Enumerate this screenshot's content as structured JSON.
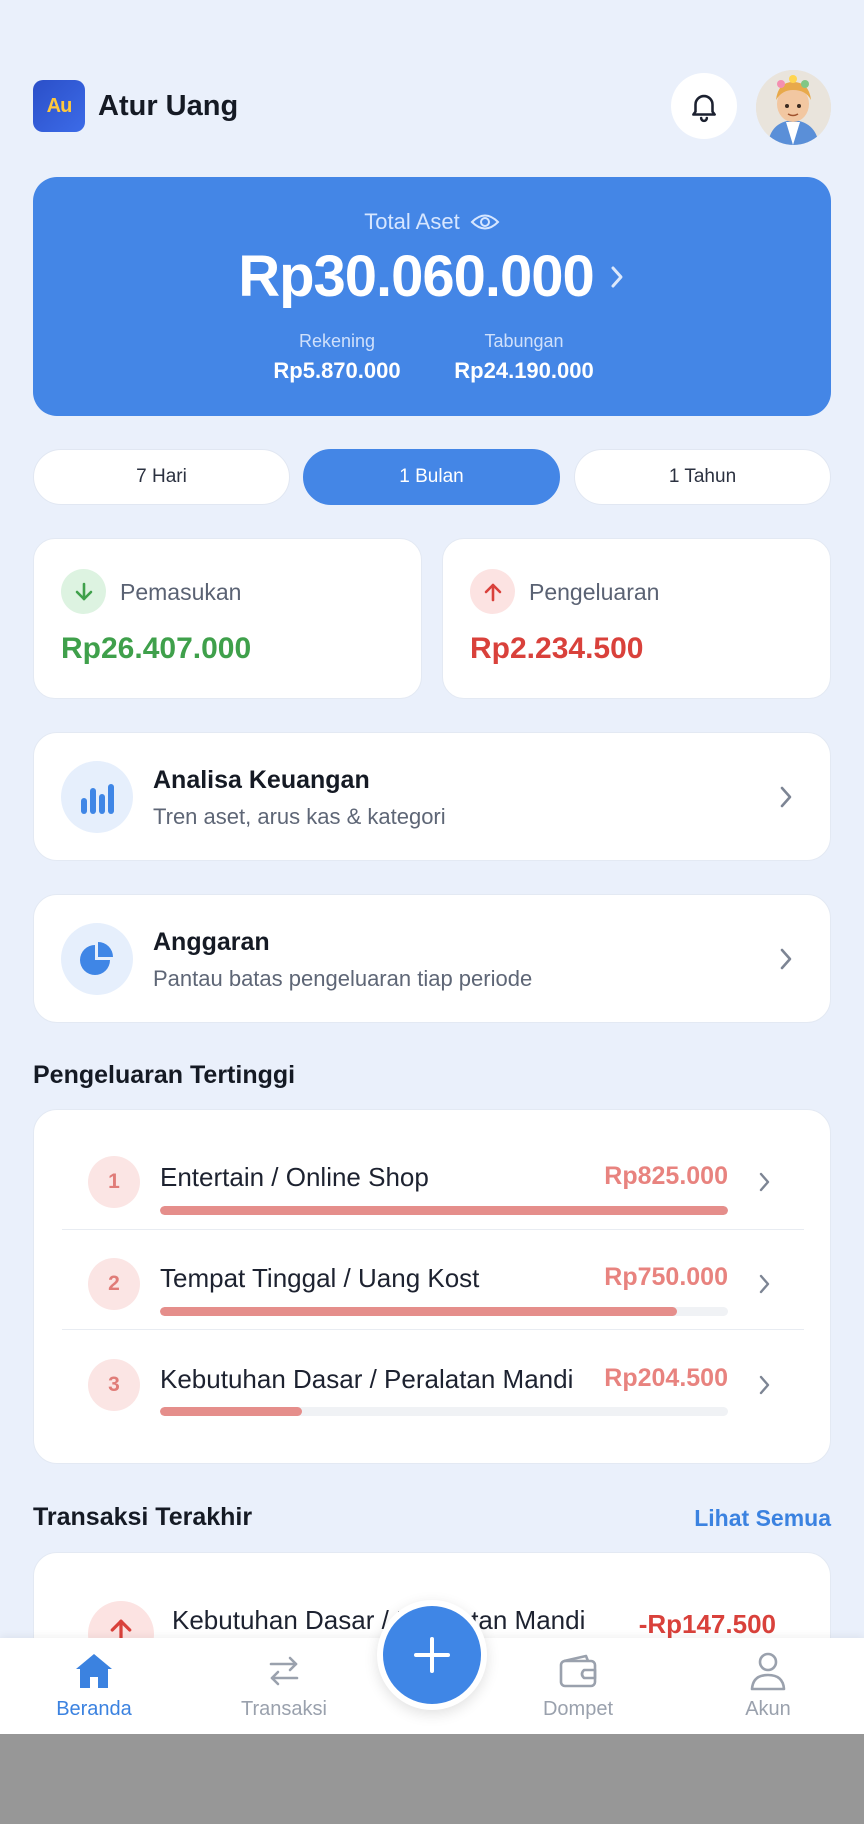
{
  "header": {
    "logo_text": "Au",
    "app_title": "Atur Uang",
    "bell_icon": "bell-icon",
    "avatar_icon": "avatar"
  },
  "assets": {
    "label": "Total Aset",
    "eye_icon": "eye-icon",
    "total": "Rp30.060.000",
    "accounts_label": "Rekening",
    "accounts_value": "Rp5.870.000",
    "savings_label": "Tabungan",
    "savings_value": "Rp24.190.000",
    "card_color": "#4486E6"
  },
  "periods": {
    "selected": "1 Bulan",
    "items": [
      "7 Hari",
      "1 Bulan",
      "1 Tahun"
    ]
  },
  "income": {
    "label": "Pemasukan",
    "value": "Rp26.407.000",
    "color": "#3FA04B",
    "icon": "arrow-down-icon"
  },
  "expense": {
    "label": "Pengeluaran",
    "value": "Rp2.234.500",
    "color": "#D9413B",
    "icon": "arrow-up-icon"
  },
  "features": [
    {
      "title": "Analisa Keuangan",
      "subtitle": "Tren aset, arus kas & kategori",
      "icon": "bar-chart-icon"
    },
    {
      "title": "Anggaran",
      "subtitle": "Pantau batas pengeluaran tiap periode",
      "icon": "pie-chart-icon"
    }
  ],
  "top_expenses": {
    "title": "Pengeluaran Tertinggi",
    "items": [
      {
        "rank": "1",
        "name": "Entertain / Online Shop",
        "amount": "Rp825.000",
        "share": 1.0
      },
      {
        "rank": "2",
        "name": "Tempat Tinggal / Uang Kost",
        "amount": "Rp750.000",
        "share": 0.91
      },
      {
        "rank": "3",
        "name": "Kebutuhan Dasar / Peralatan Mandi",
        "amount": "Rp204.500",
        "share": 0.25
      }
    ]
  },
  "transactions": {
    "title": "Transaksi Terakhir",
    "see_all": "Lihat Semua",
    "items": [
      {
        "name": "Kebutuhan Dasar / Peralatan Mandi",
        "amount": "-Rp147.500"
      }
    ]
  },
  "nav": {
    "items": [
      {
        "label": "Beranda",
        "icon": "home-icon",
        "active": true
      },
      {
        "label": "Transaksi",
        "icon": "swap-icon",
        "active": false
      },
      {
        "label": "Dompet",
        "icon": "wallet-icon",
        "active": false
      },
      {
        "label": "Akun",
        "icon": "user-icon",
        "active": false
      }
    ],
    "fab_icon": "plus-icon",
    "accent": "#3B82E0"
  }
}
